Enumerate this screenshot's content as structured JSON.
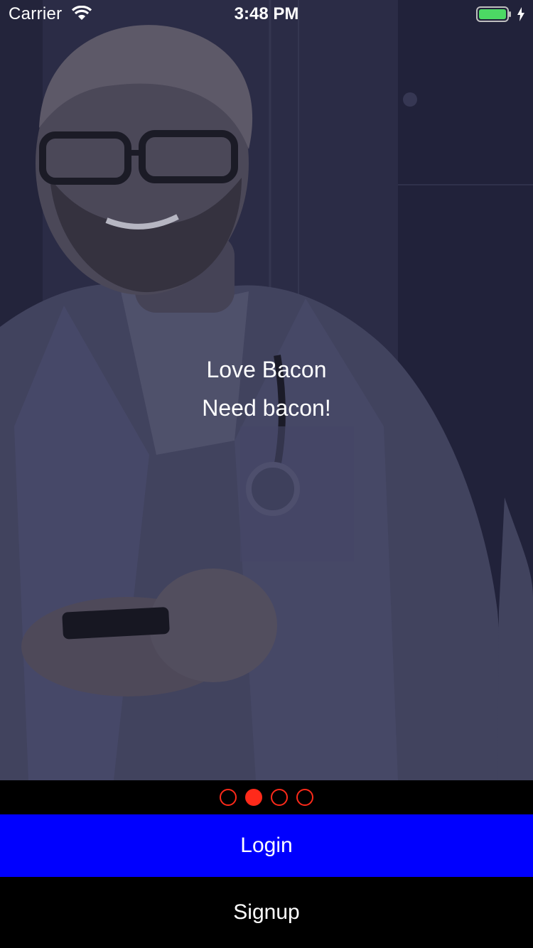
{
  "status_bar": {
    "carrier": "Carrier",
    "time": "3:48 PM",
    "wifi_icon": "wifi-icon",
    "battery_icon": "battery-icon",
    "battery_color": "#4cd964",
    "charging_icon": "bolt-icon"
  },
  "hero": {
    "image": "doctor-with-phone-photo",
    "line1": "Love Bacon",
    "line2": "Need bacon!"
  },
  "pager": {
    "count": 4,
    "active_index": 1,
    "color": "#ff2a1a"
  },
  "actions": {
    "login_label": "Login",
    "login_color": "#0000ff",
    "signup_label": "Signup"
  }
}
